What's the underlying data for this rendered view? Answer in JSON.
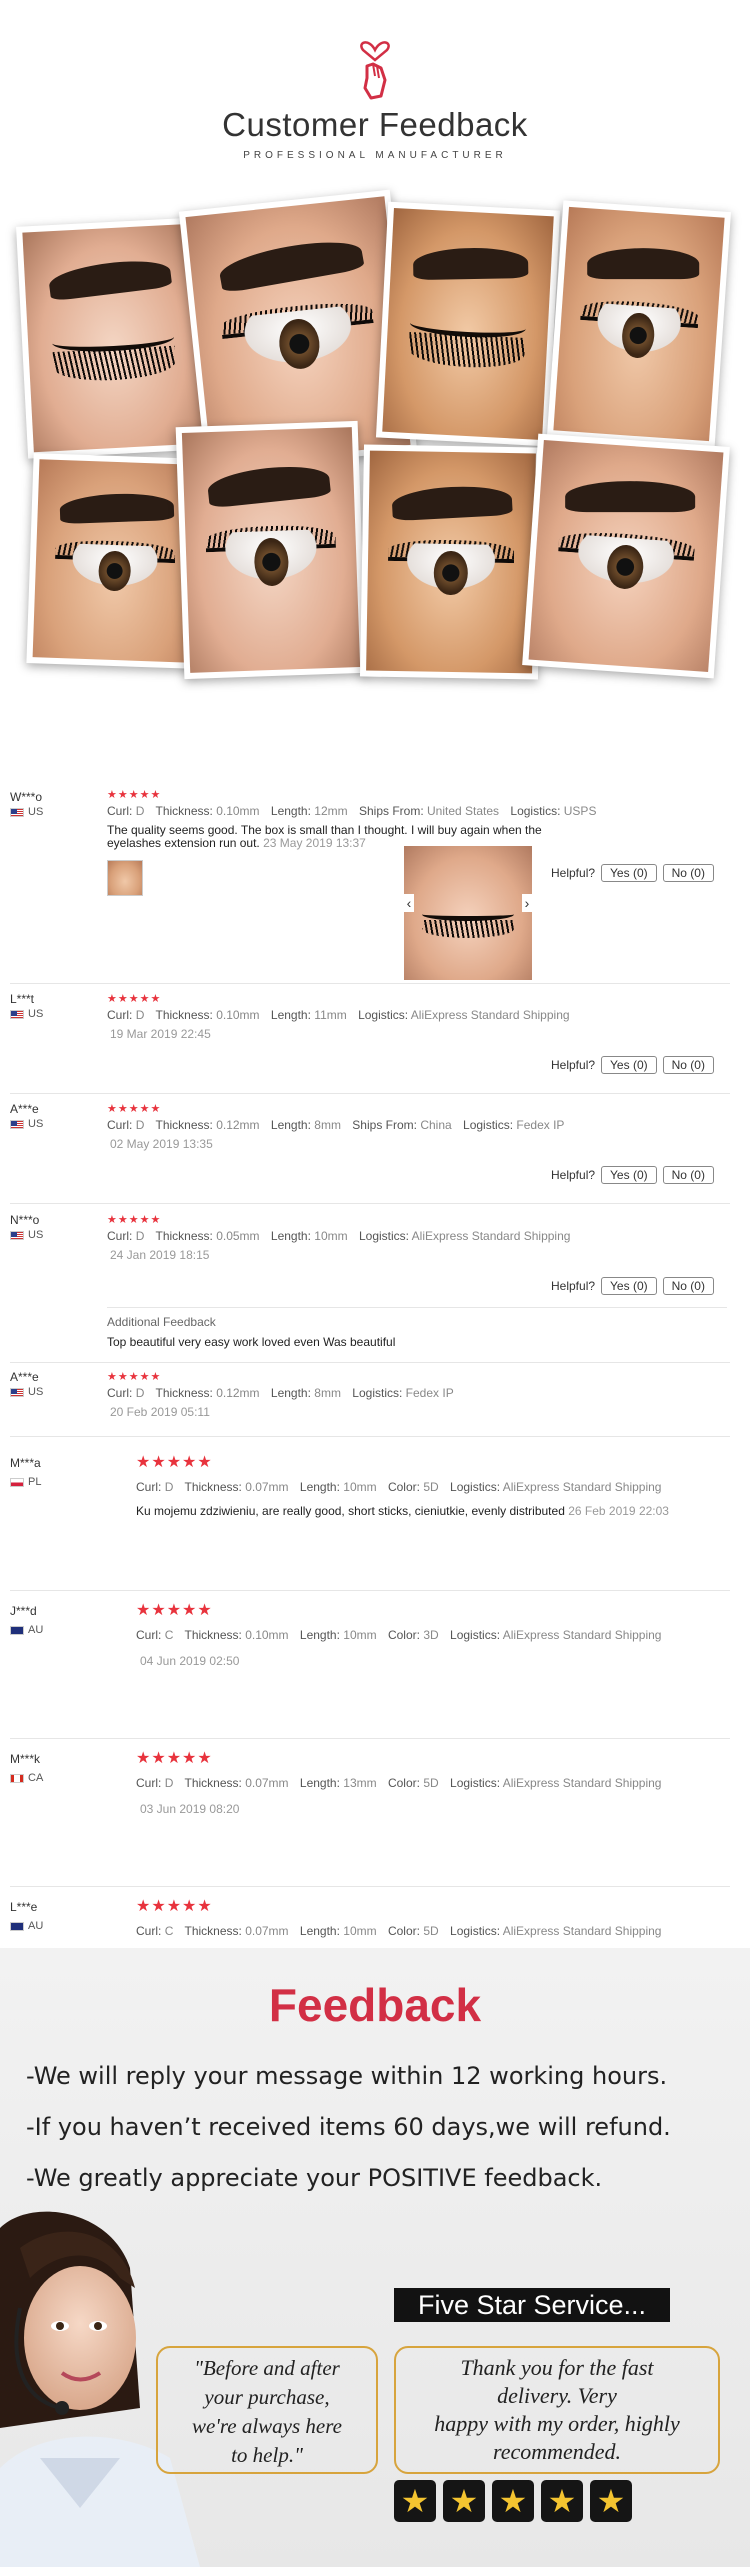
{
  "header": {
    "title": "Customer Feedback",
    "subtitle": "PROFESSIONAL MANUFACTURER",
    "logo_icon": "heart-hand-icon"
  },
  "labels": {
    "curl": "Curl:",
    "thickness": "Thickness:",
    "length": "Length:",
    "ships_from": "Ships From:",
    "logistics": "Logistics:",
    "color": "Color:",
    "helpful": "Helpful?",
    "stars": "★★★★★",
    "additional_feedback": "Additional Feedback",
    "prev_arrow": "‹",
    "next_arrow": "›"
  },
  "reviews": [
    {
      "user": "W***o",
      "country": "US",
      "flag": "flag-us",
      "curl": "D",
      "thickness": "0.10mm",
      "length": "12mm",
      "ships_from": "United States",
      "logistics": "USPS",
      "text_line1": "The quality seems good. The box is small than I thought. I will buy again when the",
      "text_line2": "eyelashes extension run out.",
      "date": "23 May 2019 13:37",
      "helpful_yes": "Yes (0)",
      "helpful_no": "No (0)"
    },
    {
      "user": "L***t",
      "country": "US",
      "flag": "flag-us",
      "curl": "D",
      "thickness": "0.10mm",
      "length": "11mm",
      "logistics": "AliExpress Standard Shipping",
      "date": "19 Mar 2019 22:45",
      "helpful_yes": "Yes (0)",
      "helpful_no": "No (0)"
    },
    {
      "user": "A***e",
      "country": "US",
      "flag": "flag-us",
      "curl": "D",
      "thickness": "0.12mm",
      "length": "8mm",
      "ships_from": "China",
      "logistics": "Fedex IP",
      "date": "02 May 2019 13:35",
      "helpful_yes": "Yes (0)",
      "helpful_no": "No (0)"
    },
    {
      "user": "N***o",
      "country": "US",
      "flag": "flag-us",
      "curl": "D",
      "thickness": "0.05mm",
      "length": "10mm",
      "logistics": "AliExpress Standard Shipping",
      "date": "24 Jan 2019 18:15",
      "helpful_yes": "Yes (0)",
      "helpful_no": "No (0)",
      "additional_text": "Top beautiful very easy work loved even Was beautiful"
    },
    {
      "user": "A***e",
      "country": "US",
      "flag": "flag-us",
      "curl": "D",
      "thickness": "0.12mm",
      "length": "8mm",
      "logistics": "Fedex IP",
      "date": "20 Feb 2019 05:11"
    },
    {
      "user": "M***a",
      "country": "PL",
      "flag": "flag-pl",
      "curl": "D",
      "thickness": "0.07mm",
      "length": "10mm",
      "color": "5D",
      "logistics": "AliExpress Standard Shipping",
      "text": "Ku mojemu zdziwieniu, are really good, short sticks, cieniutkie, evenly distributed",
      "date": "26 Feb 2019 22:03"
    },
    {
      "user": "J***d",
      "country": "AU",
      "flag": "flag-au",
      "curl": "C",
      "thickness": "0.10mm",
      "length": "10mm",
      "color": "3D",
      "logistics": "AliExpress Standard Shipping",
      "date": "04 Jun 2019 02:50"
    },
    {
      "user": "M***k",
      "country": "CA",
      "flag": "flag-ca",
      "curl": "D",
      "thickness": "0.07mm",
      "length": "13mm",
      "color": "5D",
      "logistics": "AliExpress Standard Shipping",
      "date": "03 Jun 2019 08:20"
    },
    {
      "user": "L***e",
      "country": "AU",
      "flag": "flag-au",
      "curl": "C",
      "thickness": "0.07mm",
      "length": "10mm",
      "color": "5D",
      "logistics": "AliExpress Standard Shipping"
    }
  ],
  "banner": {
    "title": "Feedback",
    "line1": "-We will reply your message within 12 working hours.",
    "line2": "-If you haven’t received items 60 days,we will refund.",
    "line3": "-We greatly appreciate your POSITIVE feedback.",
    "quote_left_1": "\"Before and after",
    "quote_left_2": "your purchase,",
    "quote_left_3": "we're always here",
    "quote_left_4": "to help.\"",
    "five_star": "Five Star Service...",
    "quote_right_1": "Thank you for the fast",
    "quote_right_2": "delivery. Very",
    "quote_right_3": "happy with my order, highly",
    "quote_right_4": "recommended.",
    "star_glyph": "★"
  },
  "colors": {
    "accent_red": "#d22f45",
    "star_red": "#e8333d",
    "gold_border": "#d7a43d",
    "star_gold": "#f4c430"
  }
}
